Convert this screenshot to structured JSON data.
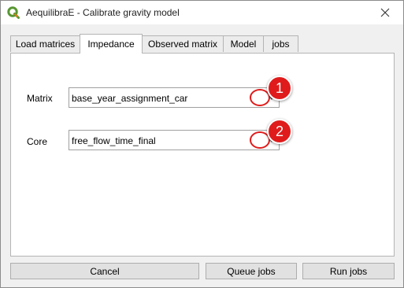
{
  "window": {
    "title": "AequilibraE - Calibrate gravity model",
    "app_icon": "qgis-icon",
    "close_icon": "close-icon"
  },
  "tabs": [
    {
      "label": "Load matrices",
      "active": false
    },
    {
      "label": "Impedance",
      "active": true
    },
    {
      "label": "Observed matrix",
      "active": false
    },
    {
      "label": "Model",
      "active": false
    },
    {
      "label": "jobs",
      "active": false
    }
  ],
  "impedance": {
    "matrix_label": "Matrix",
    "matrix_value": "base_year_assignment_car",
    "core_label": "Core",
    "core_value": "free_flow_time_final"
  },
  "annotations": {
    "marker_1": "1",
    "marker_2": "2",
    "color": "#e01b1b"
  },
  "buttons": {
    "cancel": "Cancel",
    "queue_jobs": "Queue jobs",
    "run_jobs": "Run jobs"
  }
}
